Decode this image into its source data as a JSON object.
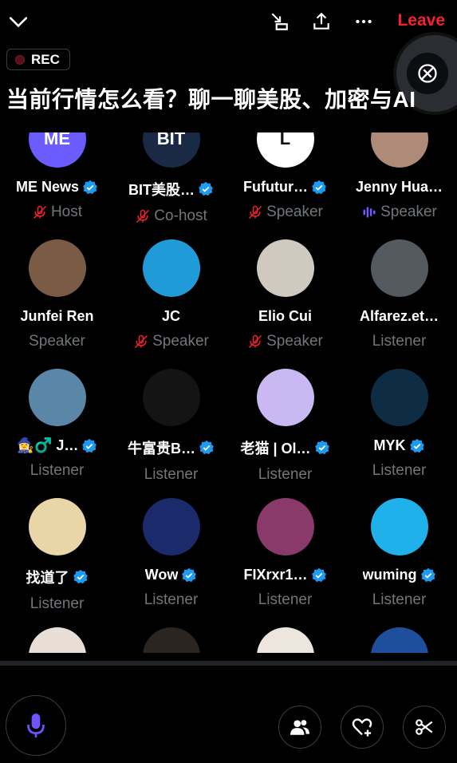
{
  "header": {
    "leave_label": "Leave"
  },
  "recording": {
    "label": "REC"
  },
  "space": {
    "title": "当前行情怎么看？聊一聊美股、加密与AI"
  },
  "participants": [
    {
      "name": "ME News",
      "verified": true,
      "role": "Host",
      "role_icon": "mic-off-icon",
      "avatar_color": "#6a5cff",
      "avatar_text": "ME"
    },
    {
      "name": "BIT美股…",
      "verified": true,
      "role": "Co-host",
      "role_icon": "mic-off-icon",
      "avatar_color": "#1a2a44",
      "avatar_text": "BIT"
    },
    {
      "name": "Fufutur…",
      "verified": true,
      "role": "Speaker",
      "role_icon": "mic-off-icon",
      "avatar_color": "#ffffff",
      "avatar_text": "L"
    },
    {
      "name": "Jenny Hua…",
      "verified": false,
      "role": "Speaker",
      "role_icon": "speaking-icon",
      "avatar_color": "#b08a78",
      "avatar_text": ""
    },
    {
      "name": "Junfei Ren",
      "verified": false,
      "role": "Speaker",
      "role_icon": "",
      "avatar_color": "#7b5a46",
      "avatar_text": ""
    },
    {
      "name": "JC",
      "verified": false,
      "role": "Speaker",
      "role_icon": "mic-off-icon",
      "avatar_color": "#1e9bd8",
      "avatar_text": ""
    },
    {
      "name": "Elio Cui",
      "verified": false,
      "role": "Speaker",
      "role_icon": "mic-off-icon",
      "avatar_color": "#cfc9c0",
      "avatar_text": ""
    },
    {
      "name": "Alfarez.et…",
      "verified": false,
      "role": "Listener",
      "role_icon": "",
      "avatar_color": "#555a60",
      "avatar_text": ""
    },
    {
      "name": "🧙‍♀️♂️ J…",
      "verified": true,
      "role": "Listener",
      "role_icon": "",
      "avatar_color": "#5a86a8",
      "avatar_text": ""
    },
    {
      "name": "牛富贵B…",
      "verified": true,
      "role": "Listener",
      "role_icon": "",
      "avatar_color": "#141414",
      "avatar_text": ""
    },
    {
      "name": "老猫 | Ol…",
      "verified": true,
      "role": "Listener",
      "role_icon": "",
      "avatar_color": "#c9b8f2",
      "avatar_text": ""
    },
    {
      "name": "MYK",
      "verified": true,
      "role": "Listener",
      "role_icon": "",
      "avatar_color": "#0e2d44",
      "avatar_text": ""
    },
    {
      "name": "找道了",
      "verified": true,
      "role": "Listener",
      "role_icon": "",
      "avatar_color": "#e8d5a8",
      "avatar_text": ""
    },
    {
      "name": "Wow",
      "verified": true,
      "role": "Listener",
      "role_icon": "",
      "avatar_color": "#1b2a6b",
      "avatar_text": ""
    },
    {
      "name": "FIXrxr1…",
      "verified": true,
      "role": "Listener",
      "role_icon": "",
      "avatar_color": "#8a3a6a",
      "avatar_text": ""
    },
    {
      "name": "wuming",
      "verified": true,
      "role": "Listener",
      "role_icon": "",
      "avatar_color": "#1fb2ea",
      "avatar_text": ""
    },
    {
      "name": "",
      "verified": false,
      "role": "",
      "role_icon": "",
      "avatar_color": "#e9ded6",
      "avatar_text": ""
    },
    {
      "name": "",
      "verified": false,
      "role": "",
      "role_icon": "",
      "avatar_color": "#2b2522",
      "avatar_text": ""
    },
    {
      "name": "",
      "verified": false,
      "role": "",
      "role_icon": "",
      "avatar_color": "#ece6df",
      "avatar_text": ""
    },
    {
      "name": "",
      "verified": false,
      "role": "",
      "role_icon": "",
      "avatar_color": "#1d4f9c",
      "avatar_text": ""
    }
  ],
  "colors": {
    "accent": "#1d9bf0",
    "leave": "#f4212e",
    "muted": "#71767b",
    "mic_off": "#f4212e",
    "speaking": "#7856ff",
    "mic": "#6e54ff"
  }
}
